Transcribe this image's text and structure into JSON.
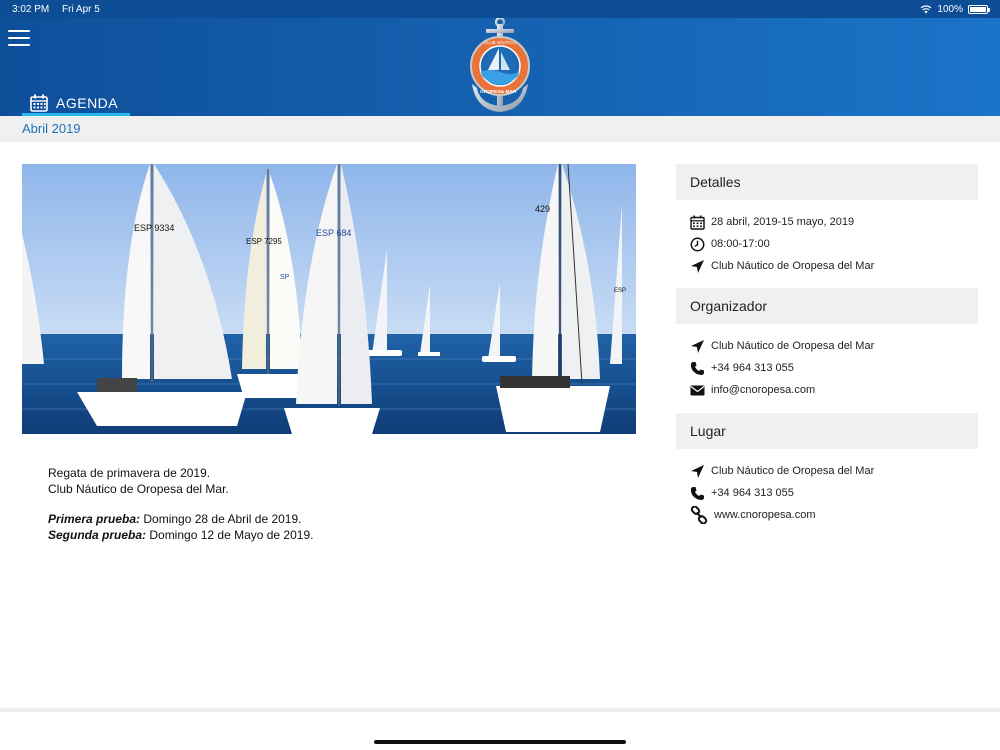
{
  "status": {
    "time": "3:02 PM",
    "date": "Fri Apr 5",
    "battery": "100%",
    "battery_level": 1.0
  },
  "header": {
    "menu_icon": "hamburger-icon",
    "logo": {
      "top_text": "CLUB NÁUTICO",
      "bottom_text_left": "OROPESA",
      "bottom_text_right": "MAR",
      "bottom_text_mid": "del"
    },
    "tab": {
      "label": "AGENDA",
      "icon": "calendar-icon"
    }
  },
  "subbar": {
    "month": "Abril 2019"
  },
  "event": {
    "lines": [
      "Regata de primavera de 2019.",
      "Club Náutico de Oropesa del Mar."
    ],
    "tests": [
      {
        "label": "Primera prueba:",
        "value": " Domingo 28 de Abril de 2019."
      },
      {
        "label": "Segunda prueba:",
        "value": " Domingo 12 de Mayo de 2019."
      }
    ],
    "sail_numbers": [
      "ESP 9334",
      "ESP 7295",
      "ESP 684",
      "429",
      "SP",
      "ESP"
    ]
  },
  "sidebar": {
    "details": {
      "title": "Detalles",
      "date": "28 abril, 2019-15 mayo, 2019",
      "time": "08:00-17:00",
      "place": "Club Náutico de Oropesa del Mar"
    },
    "organizer": {
      "title": "Organizador",
      "name": "Club Náutico de Oropesa del Mar",
      "phone": "+34 964 313 055",
      "email": "info@cnoropesa.com"
    },
    "venue": {
      "title": "Lugar",
      "name": "Club Náutico de Oropesa del Mar",
      "phone": "+34 964 313 055",
      "web": "www.cnoropesa.com"
    }
  },
  "colors": {
    "header": "#1561b0",
    "accent": "#29b6f6",
    "link": "#1f6fb8",
    "logo_orange": "#e8743b"
  }
}
